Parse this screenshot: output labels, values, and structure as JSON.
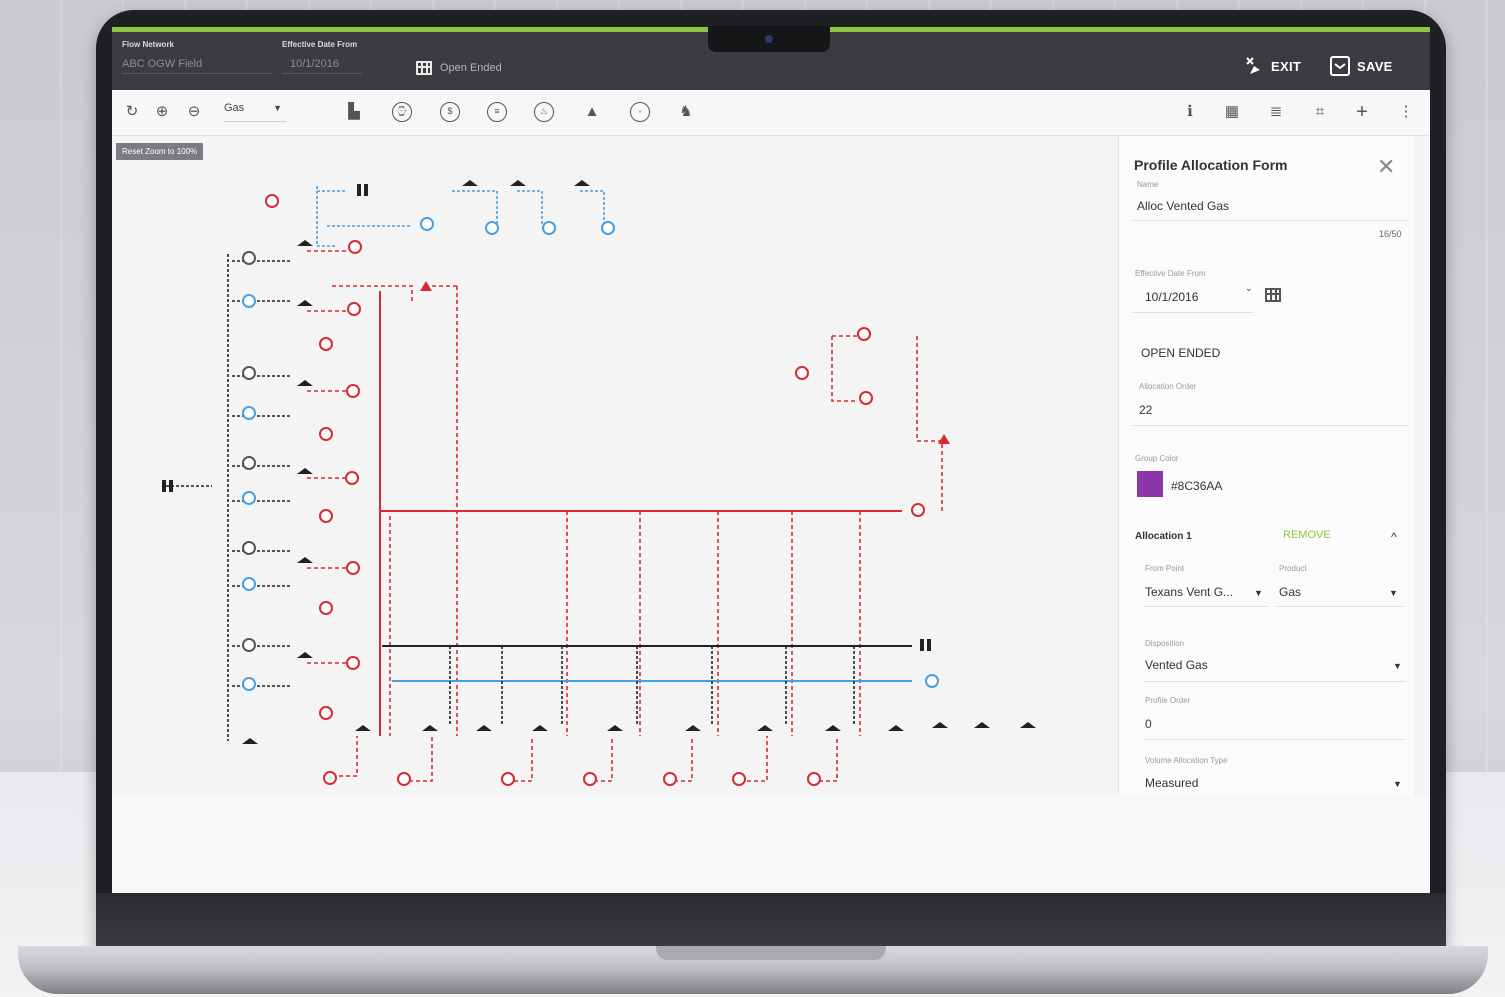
{
  "topbar": {
    "flow_network_label": "Flow Network",
    "flow_network_value": "ABC OGW Field",
    "effective_date_label": "Effective Date From",
    "effective_date_value": "10/1/2016",
    "open_ended": "Open Ended",
    "exit": "EXIT",
    "save": "SAVE"
  },
  "toolbar": {
    "product_select": "Gas",
    "reset_zoom": "Reset Zoom to 100%"
  },
  "form": {
    "title": "Profile Allocation Form",
    "name_label": "Name",
    "name_value": "Alloc Vented Gas",
    "char_count": "16/50",
    "effective_label": "Effective Date From",
    "effective_value": "10/1/2016",
    "open_ended": "OPEN ENDED",
    "order_label": "Allocation Order",
    "order_value": "22",
    "group_color_label": "Group Color",
    "group_color_value": "#8C36AA",
    "allocation_title": "Allocation 1",
    "remove": "REMOVE",
    "from_point_label": "From Point",
    "from_point_value": "Texans Vent G...",
    "product_label": "Product",
    "product_value": "Gas",
    "disposition_label": "Disposition",
    "disposition_value": "Vented Gas",
    "profile_order_label": "Profile Order",
    "profile_order_value": "0",
    "volume_type_label": "Volume Allocation Type",
    "volume_type_value": "Measured"
  },
  "colors": {
    "accent": "#8dc63f",
    "red": "#d62b35",
    "blue": "#4a9fe0",
    "group": "#8C36AA"
  }
}
